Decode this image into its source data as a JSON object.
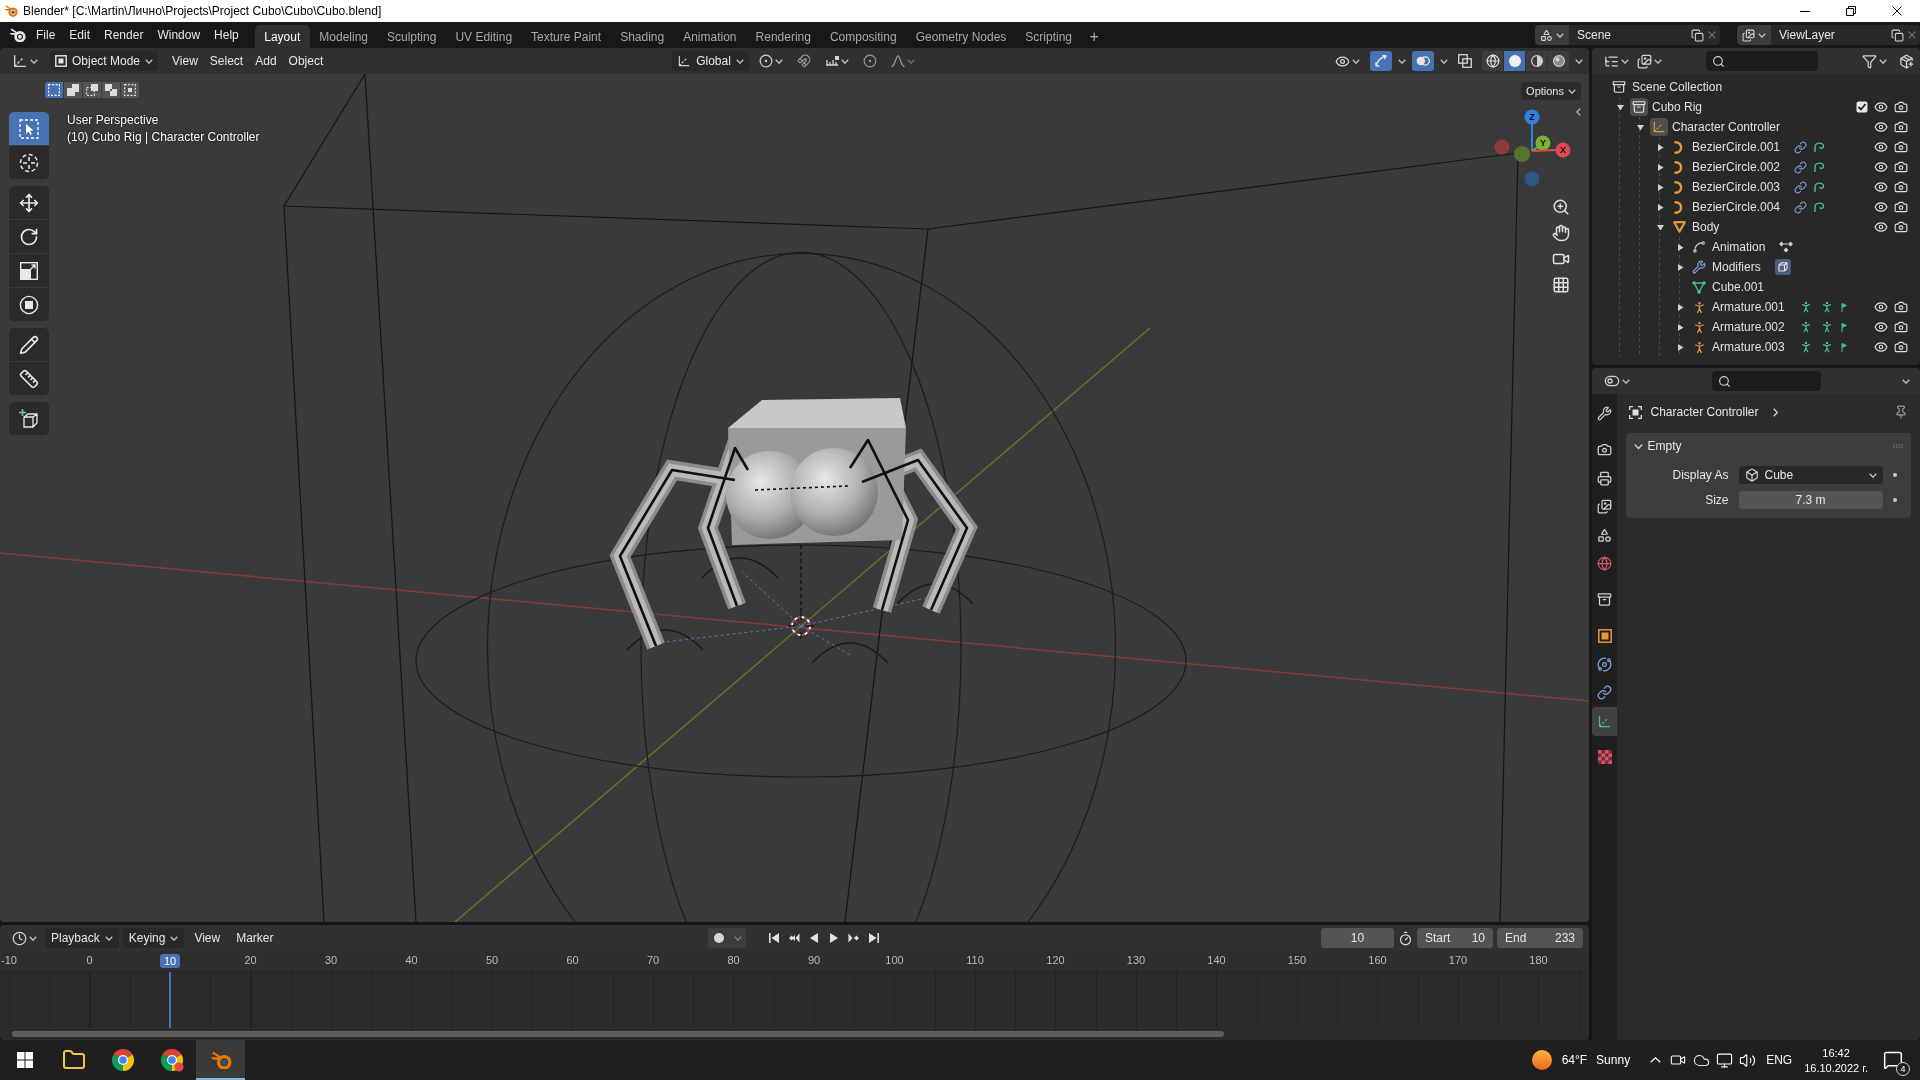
{
  "window": {
    "title": "Blender* [C:\\Martin\\Лично\\Projects\\Project Cubo\\Cubo\\Cubo.blend]"
  },
  "topbar": {
    "menus": [
      "File",
      "Edit",
      "Render",
      "Window",
      "Help"
    ],
    "workspaces": [
      {
        "label": "Layout",
        "selected": true
      },
      {
        "label": "Modeling",
        "selected": false
      },
      {
        "label": "Sculpting",
        "selected": false
      },
      {
        "label": "UV Editing",
        "selected": false
      },
      {
        "label": "Texture Paint",
        "selected": false
      },
      {
        "label": "Shading",
        "selected": false
      },
      {
        "label": "Animation",
        "selected": false
      },
      {
        "label": "Rendering",
        "selected": false
      },
      {
        "label": "Compositing",
        "selected": false
      },
      {
        "label": "Geometry Nodes",
        "selected": false
      },
      {
        "label": "Scripting",
        "selected": false
      }
    ],
    "add_workspace": "+",
    "scene": "Scene",
    "view_layer": "ViewLayer"
  },
  "viewport": {
    "mode": "Object Mode",
    "menus": [
      "View",
      "Select",
      "Add",
      "Object"
    ],
    "orientation": "Global",
    "toggles": [
      {
        "kind": "gizmos",
        "on": true
      },
      {
        "kind": "overlays",
        "on": true
      },
      {
        "kind": "xray",
        "on": false
      }
    ],
    "shading": [
      {
        "kind": "wireframe",
        "selected": false
      },
      {
        "kind": "solid",
        "selected": true
      },
      {
        "kind": "material",
        "selected": false
      },
      {
        "kind": "rendered",
        "selected": false
      }
    ],
    "select_modes": [
      {
        "kind": "set",
        "selected": true
      },
      {
        "kind": "extend",
        "selected": false
      },
      {
        "kind": "subtract",
        "selected": false
      },
      {
        "kind": "invert",
        "selected": false
      },
      {
        "kind": "intersect",
        "selected": false
      }
    ],
    "options": "Options",
    "tool_groups": [
      [
        {
          "kind": "select_box",
          "selected": true
        },
        {
          "kind": "cursor",
          "selected": false
        }
      ],
      [
        {
          "kind": "move",
          "selected": false
        },
        {
          "kind": "rotate",
          "selected": false
        },
        {
          "kind": "scale",
          "selected": false
        },
        {
          "kind": "transform",
          "selected": false
        }
      ],
      [
        {
          "kind": "annotate",
          "selected": false
        },
        {
          "kind": "measure",
          "selected": false
        }
      ],
      [
        {
          "kind": "add_cube",
          "selected": false
        }
      ]
    ],
    "info": [
      "User Perspective",
      "(10) Cubo Rig | Character Controller"
    ],
    "gizmo": {
      "x": "X",
      "y": "Y",
      "z": "Z"
    }
  },
  "outliner": {
    "items": [
      {
        "label": "Scene Collection",
        "kind": "scene_collection",
        "active": false,
        "children": [
          {
            "label": "Cubo Rig",
            "kind": "collection",
            "active": true,
            "expanded": true,
            "checked": true,
            "children": [
              {
                "label": "Character Controller",
                "kind": "empty",
                "active": true,
                "expanded": true,
                "children": [
                  {
                    "label": "BezierCircle.001",
                    "kind": "curve",
                    "active": false,
                    "expanded": false,
                    "badges": [
                      {
                        "kind": "constraint"
                      },
                      {
                        "kind": "curve_data"
                      }
                    ]
                  },
                  {
                    "label": "BezierCircle.002",
                    "kind": "curve",
                    "active": false,
                    "expanded": false,
                    "badges": [
                      {
                        "kind": "constraint"
                      },
                      {
                        "kind": "curve_data"
                      }
                    ]
                  },
                  {
                    "label": "BezierCircle.003",
                    "kind": "curve",
                    "active": false,
                    "expanded": false,
                    "badges": [
                      {
                        "kind": "constraint"
                      },
                      {
                        "kind": "curve_data"
                      }
                    ]
                  },
                  {
                    "label": "BezierCircle.004",
                    "kind": "curve",
                    "active": false,
                    "expanded": false,
                    "badges": [
                      {
                        "kind": "constraint"
                      },
                      {
                        "kind": "curve_data"
                      }
                    ]
                  },
                  {
                    "label": "Body",
                    "kind": "mesh",
                    "active": false,
                    "expanded": true,
                    "children": [
                      {
                        "label": "Animation",
                        "kind": "animation",
                        "active": false,
                        "expanded": false,
                        "badges": [
                          {
                            "kind": "keyframe"
                          }
                        ]
                      },
                      {
                        "label": "Modifiers",
                        "kind": "modifiers",
                        "active": false,
                        "expanded": false,
                        "badges": [
                          {
                            "kind": "modifier"
                          }
                        ]
                      },
                      {
                        "label": "Cube.001",
                        "kind": "mesh_data",
                        "active": false
                      },
                      {
                        "label": "Armature.001",
                        "kind": "armature",
                        "active": false,
                        "expanded": false,
                        "badges": [
                          {
                            "kind": "pose"
                          },
                          {
                            "kind": "armature_data"
                          },
                          {
                            "kind": "bone"
                          }
                        ]
                      },
                      {
                        "label": "Armature.002",
                        "kind": "armature",
                        "active": false,
                        "expanded": false,
                        "badges": [
                          {
                            "kind": "pose"
                          },
                          {
                            "kind": "armature_data"
                          },
                          {
                            "kind": "bone"
                          }
                        ]
                      },
                      {
                        "label": "Armature.003",
                        "kind": "armature",
                        "active": false,
                        "expanded": false,
                        "badges": [
                          {
                            "kind": "pose"
                          },
                          {
                            "kind": "armature_data"
                          },
                          {
                            "kind": "bone"
                          }
                        ]
                      }
                    ]
                  }
                ]
              }
            ]
          }
        ]
      }
    ]
  },
  "properties": {
    "tab_groups": [
      [
        {
          "kind": "tool",
          "selected": false
        }
      ],
      [
        {
          "kind": "render",
          "selected": false
        },
        {
          "kind": "output",
          "selected": false
        },
        {
          "kind": "view_layer",
          "selected": false
        },
        {
          "kind": "scene",
          "selected": false
        },
        {
          "kind": "world",
          "selected": false
        }
      ],
      [
        {
          "kind": "collection",
          "selected": false
        }
      ],
      [
        {
          "kind": "object",
          "selected": false
        },
        {
          "kind": "physics",
          "selected": false
        },
        {
          "kind": "constraints",
          "selected": false
        },
        {
          "kind": "data",
          "selected": true
        }
      ],
      [
        {
          "kind": "texture",
          "selected": false
        }
      ]
    ],
    "context": "Character Controller",
    "panel": {
      "title": "Empty",
      "expanded": true,
      "fields": [
        {
          "label": "Display As",
          "kind": "dropdown",
          "value": "Cube"
        },
        {
          "label": "Size",
          "kind": "number",
          "value": "7.3 m"
        }
      ]
    }
  },
  "timeline": {
    "menus": [
      {
        "label": "Playback",
        "kind": "dropdown"
      },
      {
        "label": "Keying",
        "kind": "dropdown"
      },
      {
        "label": "View",
        "kind": "menu"
      },
      {
        "label": "Marker",
        "kind": "menu"
      }
    ],
    "auto_keying": false,
    "current_frame": "10",
    "start": {
      "label": "Start",
      "value": "10"
    },
    "end": {
      "label": "End",
      "value": "233"
    },
    "ruler": [
      {
        "label": "-10",
        "selected": false
      },
      {
        "label": "0",
        "selected": false
      },
      {
        "label": "10",
        "selected": true
      },
      {
        "label": "20",
        "selected": false
      },
      {
        "label": "30",
        "selected": false
      },
      {
        "label": "40",
        "selected": false
      },
      {
        "label": "50",
        "selected": false
      },
      {
        "label": "60",
        "selected": false
      },
      {
        "label": "70",
        "selected": false
      },
      {
        "label": "80",
        "selected": false
      },
      {
        "label": "90",
        "selected": false
      },
      {
        "label": "100",
        "selected": false
      },
      {
        "label": "110",
        "selected": false
      },
      {
        "label": "120",
        "selected": false
      },
      {
        "label": "130",
        "selected": false
      },
      {
        "label": "140",
        "selected": false
      },
      {
        "label": "150",
        "selected": false
      },
      {
        "label": "160",
        "selected": false
      },
      {
        "label": "170",
        "selected": false
      },
      {
        "label": "180",
        "selected": false
      }
    ]
  },
  "taskbar": {
    "apps": [
      {
        "kind": "explorer",
        "selected": false
      },
      {
        "kind": "browser",
        "selected": false
      },
      {
        "kind": "browser_profile",
        "selected": false
      },
      {
        "kind": "blender",
        "selected": true
      }
    ],
    "weather": {
      "temperature": "64°F",
      "condition": "Sunny"
    },
    "language": "ENG",
    "time": "16:42",
    "date": "16.10.2022 г.",
    "notifications": "4"
  }
}
